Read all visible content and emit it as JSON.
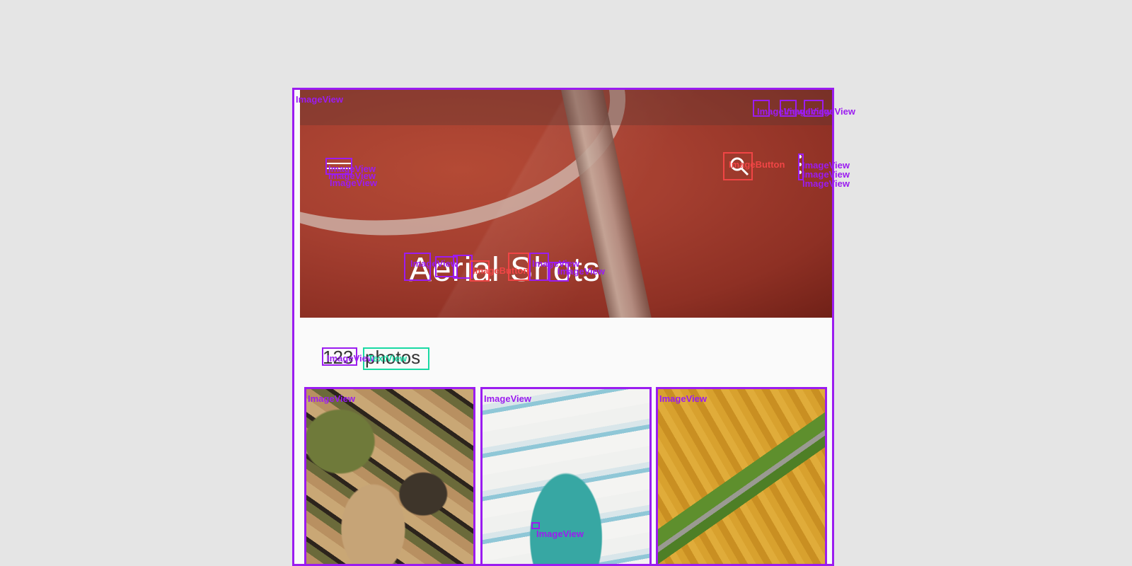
{
  "hero": {
    "title": "Aerial Shots"
  },
  "gallery": {
    "count": "123",
    "count_label": "photos"
  },
  "overlay_labels": {
    "image_view": "ImageView",
    "image_button": "ImageButton",
    "text_view": "TextView"
  },
  "colors": {
    "frame": "#9b1cf0",
    "button_box": "#f04545",
    "text_box": "#19d9a3",
    "hero": "#a53f30"
  }
}
